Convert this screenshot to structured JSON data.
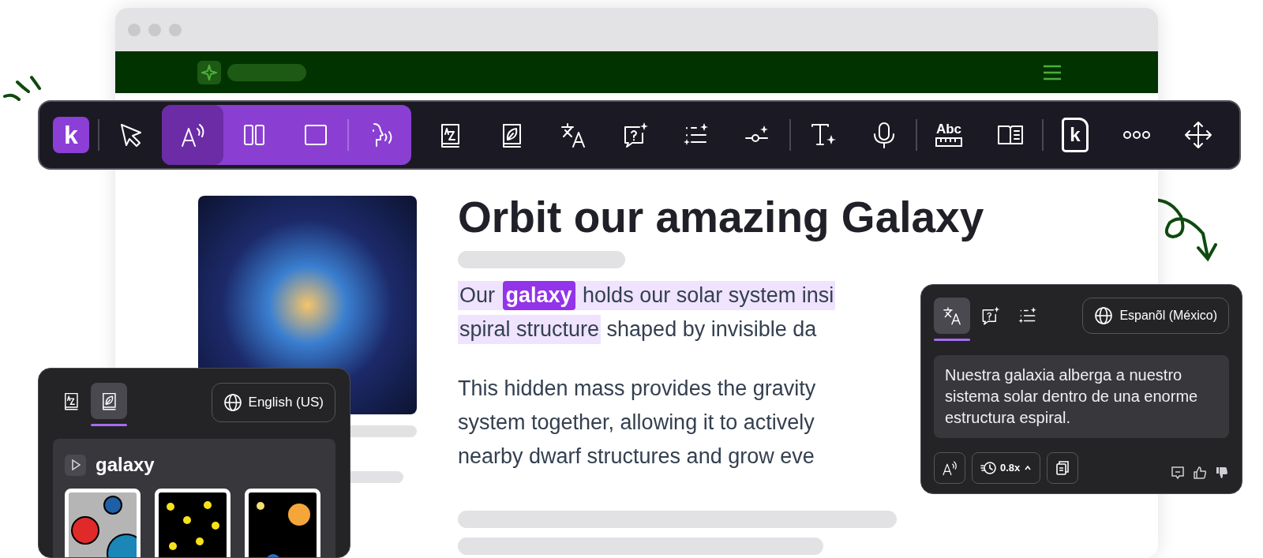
{
  "toolbar": {
    "logo": "k",
    "sections": [
      {
        "kind": "plain",
        "items": [
          {
            "kind": "separator"
          },
          {
            "kind": "tool",
            "selected": false
          }
        ]
      },
      {
        "kind": "active",
        "items": [
          {
            "kind": "tool",
            "selected": true
          },
          {
            "kind": "tool",
            "selected": false
          },
          {
            "kind": "tool",
            "selected": false
          },
          {
            "kind": "separator"
          },
          {
            "kind": "tool",
            "selected": false
          }
        ]
      },
      {
        "kind": "plain",
        "items": [
          {
            "kind": "tool",
            "selected": false
          },
          {
            "kind": "tool",
            "selected": false
          },
          {
            "kind": "tool",
            "selected": false
          },
          {
            "kind": "tool",
            "selected": false
          },
          {
            "kind": "tool",
            "selected": false
          },
          {
            "kind": "tool",
            "selected": false
          },
          {
            "kind": "separator"
          },
          {
            "kind": "tool",
            "selected": false
          },
          {
            "kind": "tool",
            "selected": false
          },
          {
            "kind": "separator"
          },
          {
            "kind": "tool",
            "selected": false,
            "label": "Abc"
          },
          {
            "kind": "tool",
            "selected": false
          },
          {
            "kind": "separator"
          },
          {
            "kind": "tool",
            "selected": false,
            "label": "k"
          },
          {
            "kind": "tool",
            "selected": false
          },
          {
            "kind": "tool",
            "selected": false
          }
        ]
      }
    ]
  },
  "article": {
    "title": "Orbit our amazing Galaxy",
    "paragraphs": [
      {
        "lines": [
          [
            {
              "text": "Our ",
              "kind": "sentence"
            },
            {
              "text": "galaxy",
              "kind": "word"
            },
            {
              "text": " holds our solar system insi",
              "kind": "sentence"
            }
          ],
          [
            {
              "text": "spiral structure",
              "kind": "sentence"
            },
            {
              "text": " shaped by invisible da",
              "kind": "plain"
            }
          ]
        ]
      },
      {
        "lines": [
          [
            {
              "text": "This hidden mass provides the gravity",
              "kind": "plain"
            }
          ],
          [
            {
              "text": "system together, allowing it to actively",
              "kind": "plain"
            }
          ],
          [
            {
              "text": "nearby dwarf structures and grow eve",
              "kind": "plain"
            }
          ]
        ]
      }
    ]
  },
  "translate_panel": {
    "tabs": [
      {
        "selected": true
      },
      {
        "selected": false
      },
      {
        "selected": false
      }
    ],
    "language": "Espanõl (México)",
    "translation": "Nuestra galaxia alberga a nuestro sistema solar dentro de una enorme estructura espiral.",
    "speed": "0.8x"
  },
  "dictionary_panel": {
    "tabs": [
      {
        "selected": false
      },
      {
        "selected": true
      }
    ],
    "language": "English (US)",
    "word": "galaxy"
  }
}
